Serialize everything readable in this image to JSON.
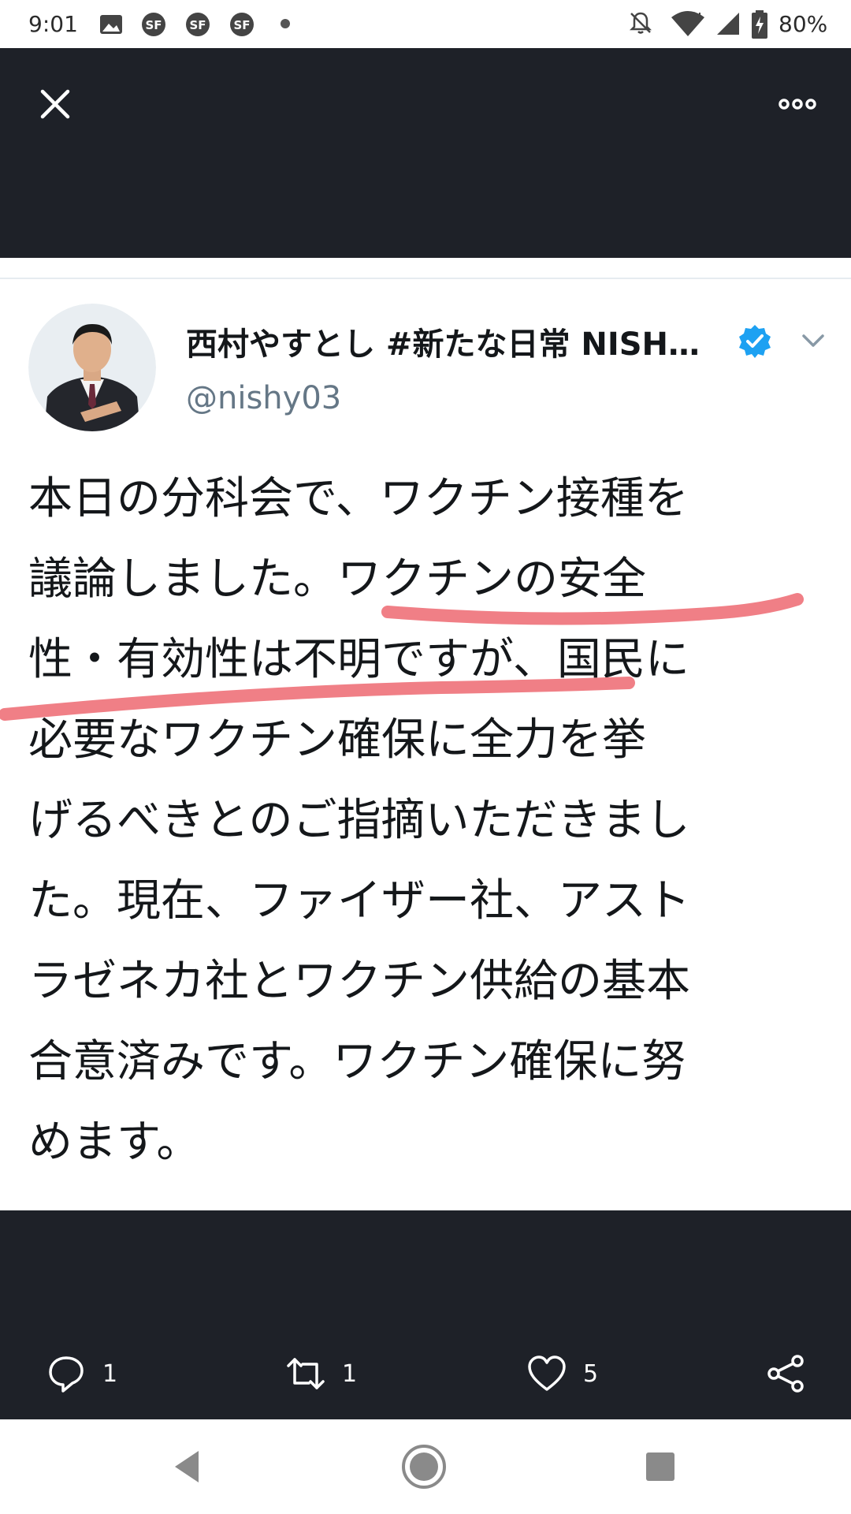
{
  "status_bar": {
    "time": "9:01",
    "battery": "80%",
    "icons": [
      "image-icon",
      "sf-icon",
      "sf-icon",
      "sf-icon",
      "dot-icon",
      "muted-bell-icon",
      "wifi-icon",
      "signal-icon",
      "battery-icon"
    ]
  },
  "tweet": {
    "display_name": "西村やすとし #新たな日常 NISH…",
    "handle": "@nishy03",
    "verified": true,
    "lines": [
      "本日の分科会で、ワクチン接種を",
      "議論しました。ワクチンの安全",
      "性・有効性は不明ですが、国民に",
      "必要なワクチン確保に全力を挙",
      "げるべきとのご指摘いただきまし",
      "た。現在、ファイザー社、アスト",
      "ラゼネカ社とワクチン供給の基本",
      "合意済みです。ワクチン確保に努",
      "めます。"
    ],
    "highlight_color": "#f07f86"
  },
  "actions": {
    "reply_count": "1",
    "retweet_count": "1",
    "like_count": "5"
  },
  "colors": {
    "dark_bg": "#1e2128",
    "verified_blue": "#1da1f2",
    "handle_gray": "#657786"
  }
}
